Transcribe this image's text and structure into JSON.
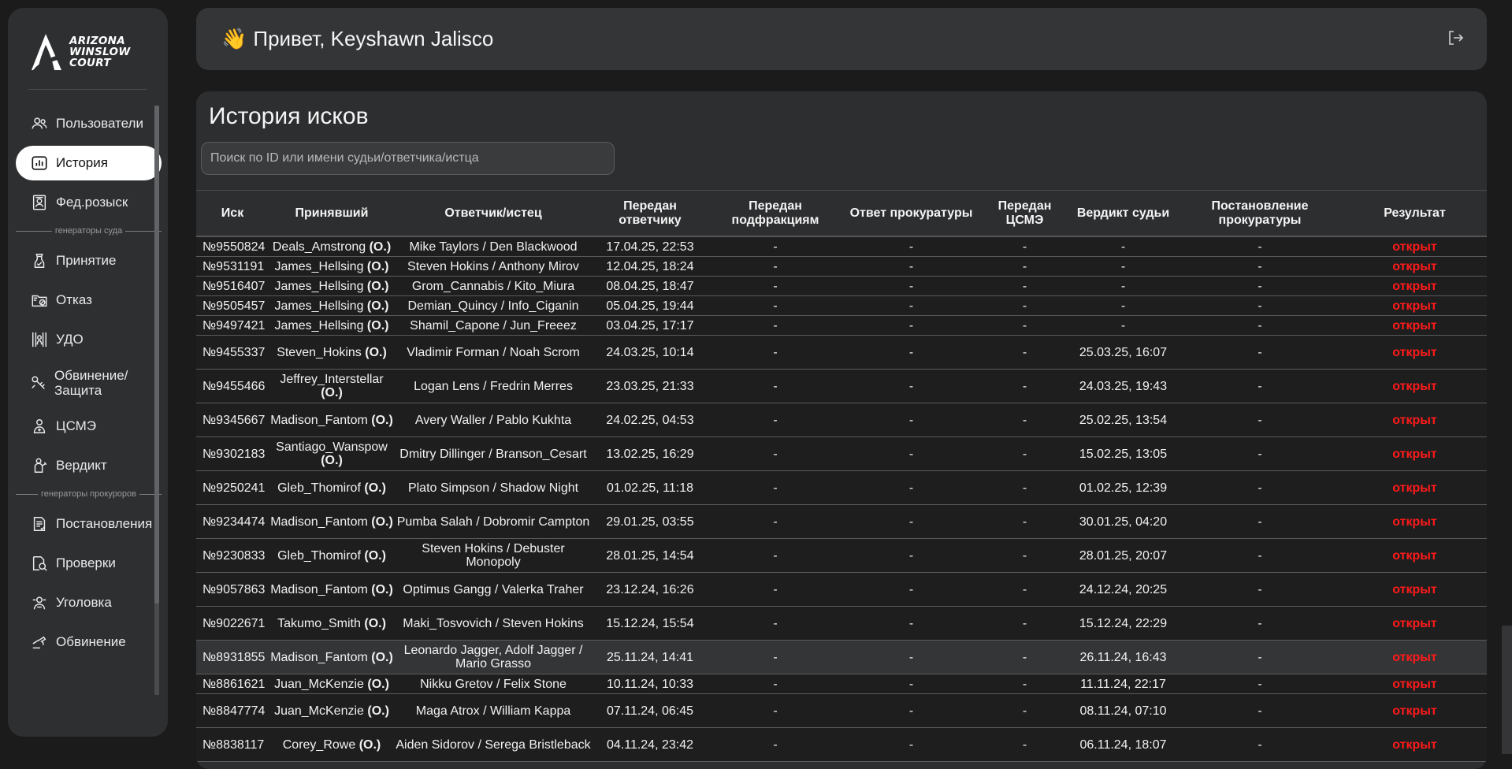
{
  "sidebar": {
    "logo_lines": [
      "ARIZONA",
      "WINSLOW",
      "COURT"
    ],
    "items": [
      {
        "label": "Пользователи",
        "icon": "users-icon"
      },
      {
        "label": "История",
        "icon": "chart-icon",
        "active": true
      },
      {
        "label": "Фед.розыск",
        "icon": "wanted-icon"
      }
    ],
    "group1_label": "генераторы суда",
    "group1_items": [
      {
        "label": "Принятие",
        "icon": "accept-icon"
      },
      {
        "label": "Отказ",
        "icon": "refuse-icon"
      },
      {
        "label": "УДО",
        "icon": "prison-icon"
      },
      {
        "label": "Обвинение/ Защита",
        "icon": "scales-icon"
      },
      {
        "label": "ЦСМЭ",
        "icon": "doctor-icon"
      },
      {
        "label": "Вердикт",
        "icon": "judge-icon"
      }
    ],
    "group2_label": "генераторы прокуроров",
    "group2_items": [
      {
        "label": "Постановления",
        "icon": "document-icon"
      },
      {
        "label": "Проверки",
        "icon": "inspect-icon"
      },
      {
        "label": "Уголовка",
        "icon": "criminal-icon"
      },
      {
        "label": "Обвинение",
        "icon": "accuse-icon"
      }
    ]
  },
  "header": {
    "wave": "👋",
    "greeting": "Привет, Keyshawn Jalisco"
  },
  "main": {
    "title": "История исков",
    "search_placeholder": "Поиск по ID или имени судьи/ответчика/истца",
    "columns": [
      "Иск",
      "Принявший",
      "Ответчик/истец",
      "Передан ответчику",
      "Передан подфракциям",
      "Ответ прокуратуры",
      "Передан ЦСМЭ",
      "Вердикт судьи",
      "Постановление прокуратуры",
      "Результат"
    ],
    "rows": [
      {
        "id": "№9550824",
        "judge": "Deals_Amstrong",
        "tag": "(О.)",
        "parties": "Mike Taylors / Den Blackwood",
        "sent": "17.04.25, 22:53",
        "sub": "-",
        "pros": "-",
        "csme": "-",
        "verdict": "-",
        "decree": "-",
        "result": "открыт",
        "size": "short"
      },
      {
        "id": "№9531191",
        "judge": "James_Hellsing",
        "tag": "(О.)",
        "parties": "Steven Hokins / Anthony Mirov",
        "sent": "12.04.25, 18:24",
        "sub": "-",
        "pros": "-",
        "csme": "-",
        "verdict": "-",
        "decree": "-",
        "result": "открыт",
        "size": "short"
      },
      {
        "id": "№9516407",
        "judge": "James_Hellsing",
        "tag": "(О.)",
        "parties": "Grom_Cannabis / Kito_Miura",
        "sent": "08.04.25, 18:47",
        "sub": "-",
        "pros": "-",
        "csme": "-",
        "verdict": "-",
        "decree": "-",
        "result": "открыт",
        "size": "short"
      },
      {
        "id": "№9505457",
        "judge": "James_Hellsing",
        "tag": "(О.)",
        "parties": "Demian_Quincy / Info_Ciganin",
        "sent": "05.04.25, 19:44",
        "sub": "-",
        "pros": "-",
        "csme": "-",
        "verdict": "-",
        "decree": "-",
        "result": "открыт",
        "size": "short"
      },
      {
        "id": "№9497421",
        "judge": "James_Hellsing",
        "tag": "(О.)",
        "parties": "Shamil_Capone / Jun_Freeez",
        "sent": "03.04.25, 17:17",
        "sub": "-",
        "pros": "-",
        "csme": "-",
        "verdict": "-",
        "decree": "-",
        "result": "открыт",
        "size": "short"
      },
      {
        "id": "№9455337",
        "judge": "Steven_Hokins",
        "tag": "(О.)",
        "parties": "Vladimir Forman / Noah Scrom",
        "sent": "24.03.25, 10:14",
        "sub": "-",
        "pros": "-",
        "csme": "-",
        "verdict": "25.03.25, 16:07",
        "decree": "-",
        "result": "открыт",
        "size": "tall"
      },
      {
        "id": "№9455466",
        "judge": "Jeffrey_Interstellar",
        "tag": "(О.)",
        "parties": "Logan Lens / Fredrin Merres",
        "sent": "23.03.25, 21:33",
        "sub": "-",
        "pros": "-",
        "csme": "-",
        "verdict": "24.03.25, 19:43",
        "decree": "-",
        "result": "открыт",
        "size": "tall"
      },
      {
        "id": "№9345667",
        "judge": "Madison_Fantom",
        "tag": "(О.)",
        "parties": "Avery Waller / Pablo Kukhta",
        "sent": "24.02.25, 04:53",
        "sub": "-",
        "pros": "-",
        "csme": "-",
        "verdict": "25.02.25, 13:54",
        "decree": "-",
        "result": "открыт",
        "size": "tall"
      },
      {
        "id": "№9302183",
        "judge": "Santiago_Wanspow",
        "tag": "(О.)",
        "parties": "Dmitry Dillinger / Branson_Cesart",
        "sent": "13.02.25, 16:29",
        "sub": "-",
        "pros": "-",
        "csme": "-",
        "verdict": "15.02.25, 13:05",
        "decree": "-",
        "result": "открыт",
        "size": "tall"
      },
      {
        "id": "№9250241",
        "judge": "Gleb_Thomirof",
        "tag": "(О.)",
        "parties": "Plato Simpson / Shadow Night",
        "sent": "01.02.25, 11:18",
        "sub": "-",
        "pros": "-",
        "csme": "-",
        "verdict": "01.02.25, 12:39",
        "decree": "-",
        "result": "открыт",
        "size": "tall"
      },
      {
        "id": "№9234474",
        "judge": "Madison_Fantom",
        "tag": "(О.)",
        "parties": "Pumba Salah / Dobromir Campton",
        "sent": "29.01.25, 03:55",
        "sub": "-",
        "pros": "-",
        "csme": "-",
        "verdict": "30.01.25, 04:20",
        "decree": "-",
        "result": "открыт",
        "size": "tall"
      },
      {
        "id": "№9230833",
        "judge": "Gleb_Thomirof",
        "tag": "(О.)",
        "parties": "Steven Hokins / Debuster Monopoly",
        "sent": "28.01.25, 14:54",
        "sub": "-",
        "pros": "-",
        "csme": "-",
        "verdict": "28.01.25, 20:07",
        "decree": "-",
        "result": "открыт",
        "size": "tall"
      },
      {
        "id": "№9057863",
        "judge": "Madison_Fantom",
        "tag": "(О.)",
        "parties": "Optimus Gangg / Valerka Traher",
        "sent": "23.12.24, 16:26",
        "sub": "-",
        "pros": "-",
        "csme": "-",
        "verdict": "24.12.24, 20:25",
        "decree": "-",
        "result": "открыт",
        "size": "tall"
      },
      {
        "id": "№9022671",
        "judge": "Takumo_Smith",
        "tag": "(О.)",
        "parties": "Maki_Tosvovich / Steven Hokins",
        "sent": "15.12.24, 15:54",
        "sub": "-",
        "pros": "-",
        "csme": "-",
        "verdict": "15.12.24, 22:29",
        "decree": "-",
        "result": "открыт",
        "size": "tall"
      },
      {
        "id": "№8931855",
        "judge": "Madison_Fantom",
        "tag": "(О.)",
        "parties": "Leonardo Jagger, Adolf Jagger / Mario Grasso",
        "sent": "25.11.24, 14:41",
        "sub": "-",
        "pros": "-",
        "csme": "-",
        "verdict": "26.11.24, 16:43",
        "decree": "-",
        "result": "открыт",
        "size": "tall",
        "highlight": true
      },
      {
        "id": "№8861621",
        "judge": "Juan_McKenzie",
        "tag": "(О.)",
        "parties": "Nikku Gretov / Felix Stone",
        "sent": "10.11.24, 10:33",
        "sub": "-",
        "pros": "-",
        "csme": "-",
        "verdict": "11.11.24, 22:17",
        "decree": "-",
        "result": "открыт",
        "size": "short"
      },
      {
        "id": "№8847774",
        "judge": "Juan_McKenzie",
        "tag": "(О.)",
        "parties": "Maga Atrox / William Kappa",
        "sent": "07.11.24, 06:45",
        "sub": "-",
        "pros": "-",
        "csme": "-",
        "verdict": "08.11.24, 07:10",
        "decree": "-",
        "result": "открыт",
        "size": "tall"
      },
      {
        "id": "№8838117",
        "judge": "Corey_Rowe",
        "tag": "(О.)",
        "parties": "Aiden Sidorov / Serega Bristleback",
        "sent": "04.11.24, 23:42",
        "sub": "-",
        "pros": "-",
        "csme": "-",
        "verdict": "06.11.24, 18:07",
        "decree": "-",
        "result": "открыт",
        "size": "tall"
      }
    ]
  }
}
